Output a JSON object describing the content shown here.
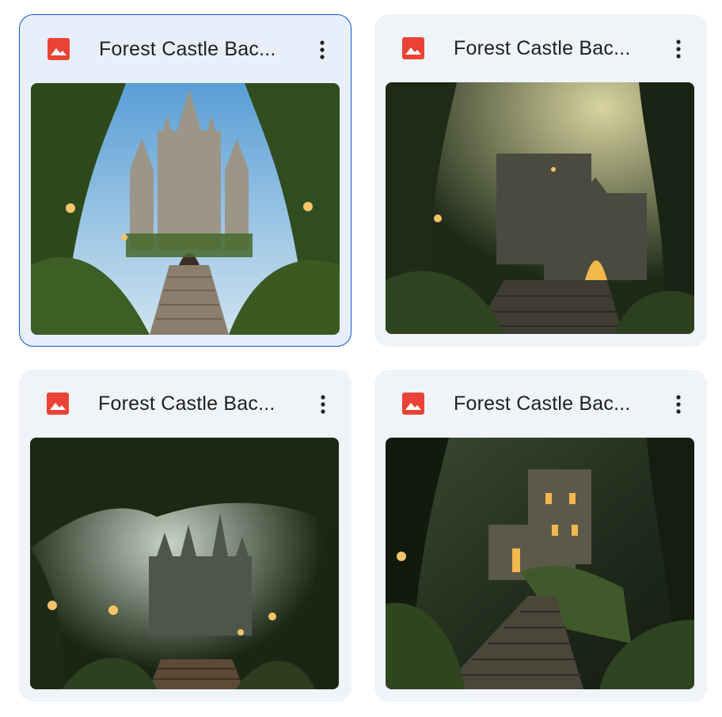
{
  "files": [
    {
      "name": "Forest Castle Bac...",
      "type_icon": "image-icon",
      "selected": true
    },
    {
      "name": "Forest Castle Bac...",
      "type_icon": "image-icon",
      "selected": false
    },
    {
      "name": "Forest Castle Bac...",
      "type_icon": "image-icon",
      "selected": false
    },
    {
      "name": "Forest Castle Bac...",
      "type_icon": "image-icon",
      "selected": false
    }
  ],
  "more_actions_icon": "more-vert-icon",
  "colors": {
    "accent": "#0b57d0",
    "card_bg": "#f0f4f9",
    "image_icon": "#ea4335"
  }
}
